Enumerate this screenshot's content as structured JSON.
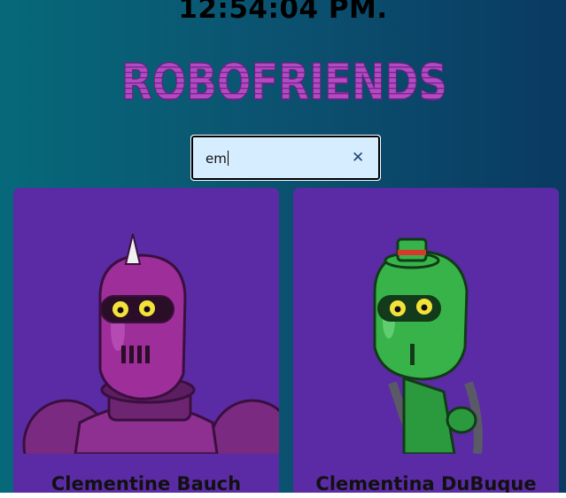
{
  "header": {
    "clock": "12:54:04 PM.",
    "brand": "ROBOFRIENDS"
  },
  "search": {
    "value": "em",
    "clear_icon": "close-icon"
  },
  "robots": [
    {
      "name": "Clementine Bauch"
    },
    {
      "name": "Clementina DuBuque"
    }
  ],
  "colors": {
    "card_bg": "#5a2ba4",
    "brand": "#b14bc2",
    "search_bg": "#d6ecff"
  }
}
